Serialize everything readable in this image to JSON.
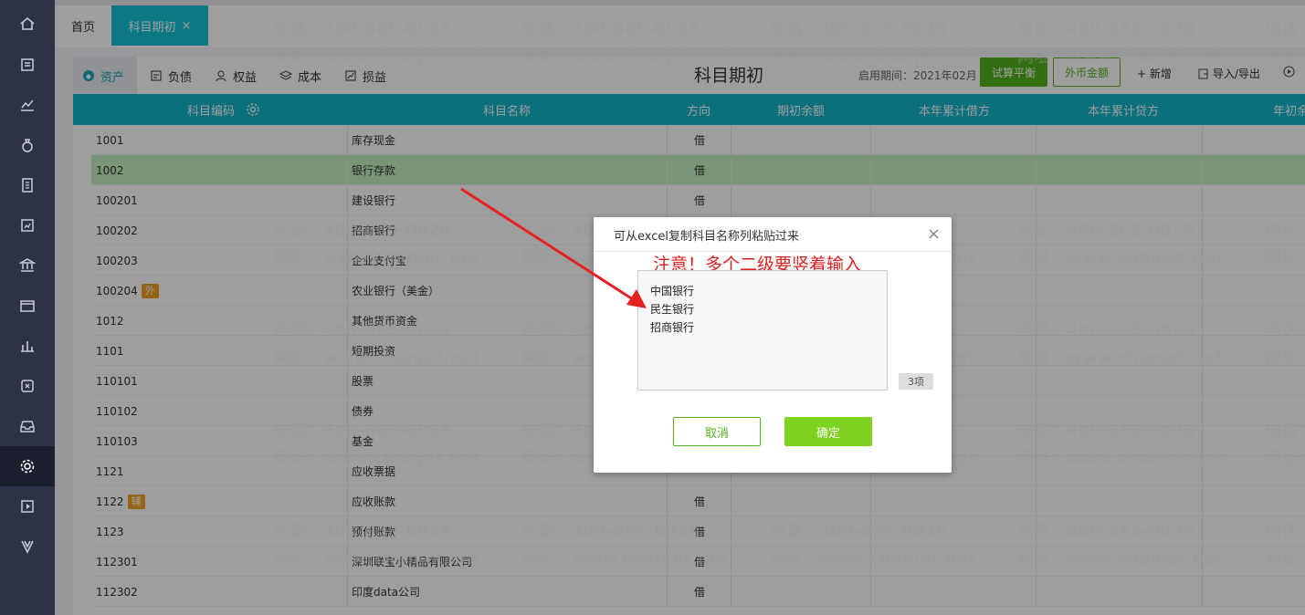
{
  "tabs": {
    "home": "首页",
    "active": "科目期初",
    "close": "×"
  },
  "categories": [
    {
      "label": "资产",
      "icon": "asset-icon"
    },
    {
      "label": "负债",
      "icon": "liability-icon"
    },
    {
      "label": "权益",
      "icon": "equity-icon"
    },
    {
      "label": "成本",
      "icon": "cost-icon"
    },
    {
      "label": "损益",
      "icon": "pnl-icon"
    }
  ],
  "toolbar": {
    "title": "科目期初",
    "period": "启用期间：2021年02月",
    "trial_balance": "试算平衡",
    "foreign_amount": "外币金额",
    "add": "+ 新增",
    "import_export": "导入/导出"
  },
  "table": {
    "headers": [
      "科目编码",
      "科目名称",
      "方向",
      "期初余额",
      "本年累计借方",
      "本年累计贷方",
      "年初余额"
    ],
    "rows": [
      {
        "code": "1001",
        "name": "库存现金",
        "dir": "借",
        "badge": ""
      },
      {
        "code": "1002",
        "name": "银行存款",
        "dir": "借",
        "badge": ""
      },
      {
        "code": "100201",
        "name": "建设银行",
        "dir": "借",
        "badge": ""
      },
      {
        "code": "100202",
        "name": "招商银行",
        "dir": "",
        "badge": ""
      },
      {
        "code": "100203",
        "name": "企业支付宝",
        "dir": "",
        "badge": ""
      },
      {
        "code": "100204",
        "name": "农业银行（美金）",
        "dir": "",
        "badge": "外"
      },
      {
        "code": "1012",
        "name": "其他货币资金",
        "dir": "",
        "badge": ""
      },
      {
        "code": "1101",
        "name": "短期投资",
        "dir": "",
        "badge": ""
      },
      {
        "code": "110101",
        "name": "股票",
        "dir": "",
        "badge": ""
      },
      {
        "code": "110102",
        "name": "债券",
        "dir": "",
        "badge": ""
      },
      {
        "code": "110103",
        "name": "基金",
        "dir": "",
        "badge": ""
      },
      {
        "code": "1121",
        "name": "应收票据",
        "dir": "",
        "badge": ""
      },
      {
        "code": "1122",
        "name": "应收账款",
        "dir": "借",
        "badge": "辅"
      },
      {
        "code": "1123",
        "name": "预付账款",
        "dir": "借",
        "badge": ""
      },
      {
        "code": "112301",
        "name": "深圳联宝小精品有限公司",
        "dir": "借",
        "badge": ""
      },
      {
        "code": "112302",
        "name": "印度data公司",
        "dir": "借",
        "badge": ""
      }
    ]
  },
  "watermark": {
    "phone": "电话：400-665-0028",
    "site": "网址：www.chanjet.net"
  },
  "dialog": {
    "title": "可从excel复制科目名称列粘贴过来",
    "close": "×",
    "note": "注意！多个二级要竖着输入",
    "lines": [
      "中国银行",
      "民生银行",
      "招商银行"
    ],
    "count": "3项",
    "cancel": "取消",
    "ok": "确定"
  },
  "colors": {
    "accent": "#13b3c9",
    "green": "#52b41d",
    "sidebar": "#2e3247",
    "note_red": "#e02020"
  }
}
